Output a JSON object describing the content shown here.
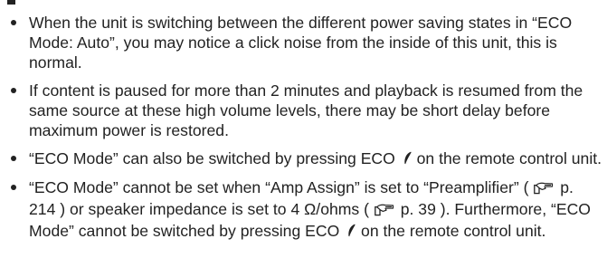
{
  "notes": [
    {
      "text": "When the unit is switching between the different power saving states in “ECO Mode: Auto”, you may notice a click noise from the inside of this unit, this is normal."
    },
    {
      "text": "If content is paused for more than 2 minutes and playback is resumed from the same source at these high volume levels, there may be short delay before maximum power is restored."
    },
    {
      "before_icon": "“ECO Mode” can also be switched by pressing ECO",
      "after_icon": " on the remote control unit.",
      "icon": "eco-leaf-icon"
    },
    {
      "part1": "“ECO Mode” cannot be set when “Amp Assign” is set to “Preamplifier” (",
      "ref1": "p. 214",
      "part2": ") or speaker impedance is set to 4 Ω/ohms (",
      "ref2": "p. 39",
      "part3": "). Furthermore, “ECO Mode” cannot be switched by pressing ECO",
      "part4": " on the remote control unit.",
      "ref_icon": "page-reference-icon",
      "icon": "eco-leaf-icon"
    }
  ]
}
